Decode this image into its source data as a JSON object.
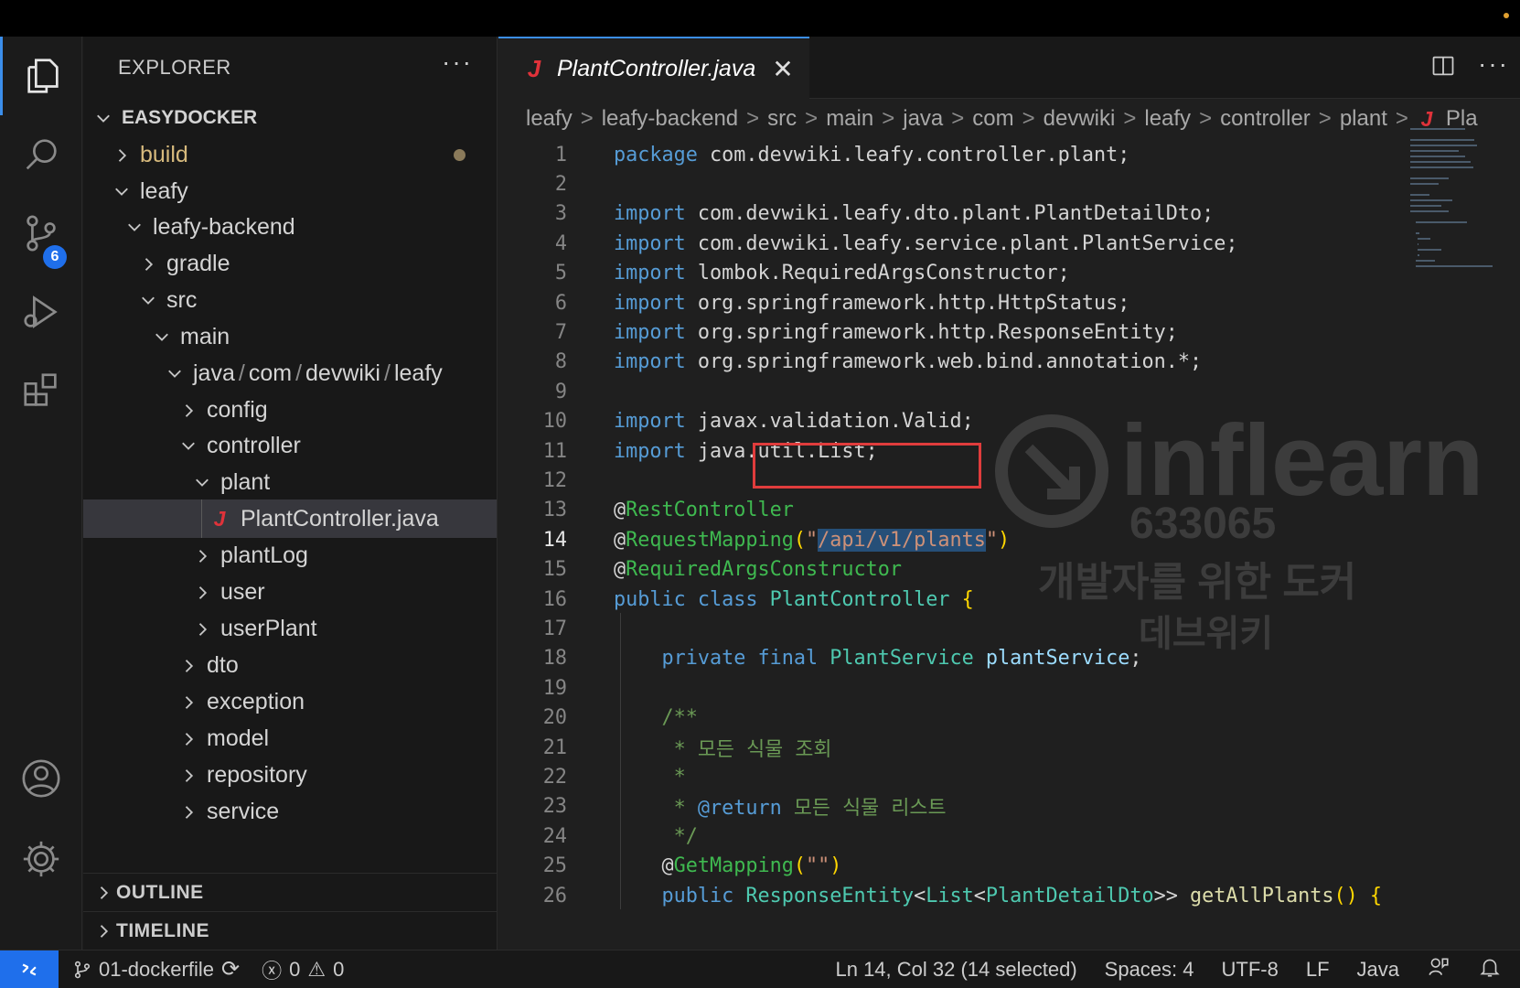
{
  "explorer": {
    "header": "EXPLORER",
    "more": "···",
    "root": "EASYDOCKER",
    "items": [
      {
        "label": "build",
        "expanded": false,
        "modified": true
      },
      {
        "label": "leafy",
        "expanded": true
      },
      {
        "label": "leafy-backend",
        "expanded": true
      },
      {
        "label": "gradle",
        "expanded": false
      },
      {
        "label": "src",
        "expanded": true
      },
      {
        "label": "main",
        "expanded": true
      },
      {
        "label_parts": [
          "java",
          "com",
          "devwiki",
          "leafy"
        ],
        "expanded": true
      },
      {
        "label": "config",
        "expanded": false
      },
      {
        "label": "controller",
        "expanded": true
      },
      {
        "label": "plant",
        "expanded": true
      },
      {
        "label": "PlantController.java",
        "file": true,
        "selected": true
      },
      {
        "label": "plantLog",
        "expanded": false
      },
      {
        "label": "user",
        "expanded": false
      },
      {
        "label": "userPlant",
        "expanded": false
      },
      {
        "label": "dto",
        "expanded": false
      },
      {
        "label": "exception",
        "expanded": false
      },
      {
        "label": "model",
        "expanded": false
      },
      {
        "label": "repository",
        "expanded": false
      },
      {
        "label": "service",
        "expanded": false
      }
    ],
    "path_sep": "/",
    "outline": "OUTLINE",
    "timeline": "TIMELINE"
  },
  "activity": {
    "scm_badge": "6",
    "icons": [
      "explorer-icon",
      "search-icon",
      "source-control-icon",
      "run-debug-icon",
      "extensions-icon",
      "account-icon",
      "settings-gear-icon"
    ]
  },
  "tab": {
    "java_letter": "J",
    "title": "PlantController.java",
    "close": "✕",
    "more": "···"
  },
  "breadcrumb": [
    "leafy",
    "leafy-backend",
    "src",
    "main",
    "java",
    "com",
    "devwiki",
    "leafy",
    "controller",
    "plant",
    "Pla"
  ],
  "breadcrumb_sep": ">",
  "code": {
    "current_line": 14,
    "lines": [
      {
        "n": "1",
        "text": "package com.devwiki.leafy.controller.plant;"
      },
      {
        "n": "2",
        "text": ""
      },
      {
        "n": "3",
        "text": "import com.devwiki.leafy.dto.plant.PlantDetailDto;"
      },
      {
        "n": "4",
        "text": "import com.devwiki.leafy.service.plant.PlantService;"
      },
      {
        "n": "5",
        "text": "import lombok.RequiredArgsConstructor;"
      },
      {
        "n": "6",
        "text": "import org.springframework.http.HttpStatus;"
      },
      {
        "n": "7",
        "text": "import org.springframework.http.ResponseEntity;"
      },
      {
        "n": "8",
        "text": "import org.springframework.web.bind.annotation.*;"
      },
      {
        "n": "9",
        "text": ""
      },
      {
        "n": "10",
        "text": "import javax.validation.Valid;"
      },
      {
        "n": "11",
        "text": "import java.util.List;"
      },
      {
        "n": "12",
        "text": ""
      },
      {
        "n": "13",
        "text": "@RestController"
      },
      {
        "n": "14",
        "text": "@RequestMapping(\"/api/v1/plants\")"
      },
      {
        "n": "15",
        "text": "@RequiredArgsConstructor"
      },
      {
        "n": "16",
        "text": "public class PlantController {"
      },
      {
        "n": "17",
        "text": ""
      },
      {
        "n": "18",
        "text": "    private final PlantService plantService;"
      },
      {
        "n": "19",
        "text": ""
      },
      {
        "n": "20",
        "text": "    /**"
      },
      {
        "n": "21",
        "text": "     * 모든 식물 조회"
      },
      {
        "n": "22",
        "text": "     *"
      },
      {
        "n": "23",
        "text": "     * @return 모든 식물 리스트"
      },
      {
        "n": "24",
        "text": "     */"
      },
      {
        "n": "25",
        "text": "    @GetMapping(\"\")"
      },
      {
        "n": "26",
        "text": "    public ResponseEntity<List<PlantDetailDto>> getAllPlants() {"
      }
    ]
  },
  "watermark": {
    "brand": "inflearn",
    "id": "633065",
    "line1": "개발자를 위한 도커",
    "line2": "데브위키"
  },
  "status": {
    "branch": "01-dockerfile",
    "errors": "0",
    "warnings": "0",
    "position": "Ln 14, Col 32 (14 selected)",
    "spaces": "Spaces: 4",
    "encoding": "UTF-8",
    "eol": "LF",
    "language": "Java"
  },
  "colors": {
    "accent": "#3b8eea",
    "remote": "#1f6feb",
    "highlight_box": "#e03c3c",
    "java_icon": "#e0323a"
  }
}
